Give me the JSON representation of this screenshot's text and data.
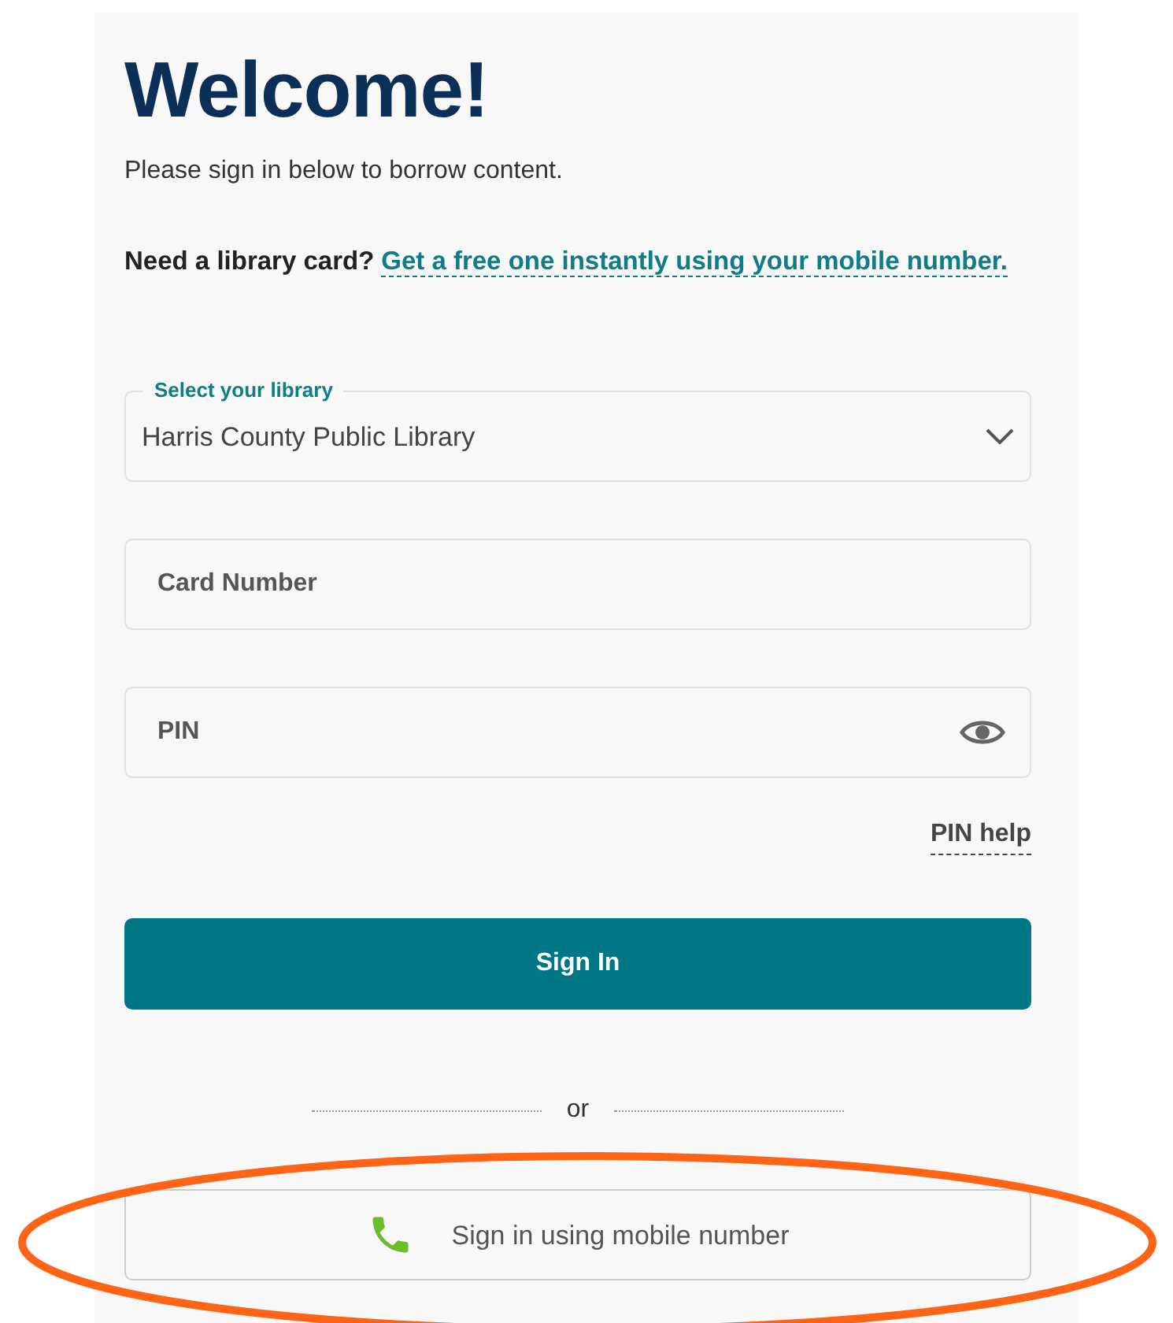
{
  "heading": "Welcome!",
  "intro": "Please sign in below to borrow content.",
  "card_prompt": {
    "text": "Need a library card?",
    "link": "Get a free one instantly using your mobile number."
  },
  "library_select": {
    "label": "Select your library",
    "value": "Harris County Public Library"
  },
  "card_number": {
    "placeholder": "Card Number"
  },
  "pin": {
    "placeholder": "PIN"
  },
  "pin_help": "PIN help",
  "sign_in_button": "Sign In",
  "divider": "or",
  "mobile_button": "Sign in using mobile number"
}
